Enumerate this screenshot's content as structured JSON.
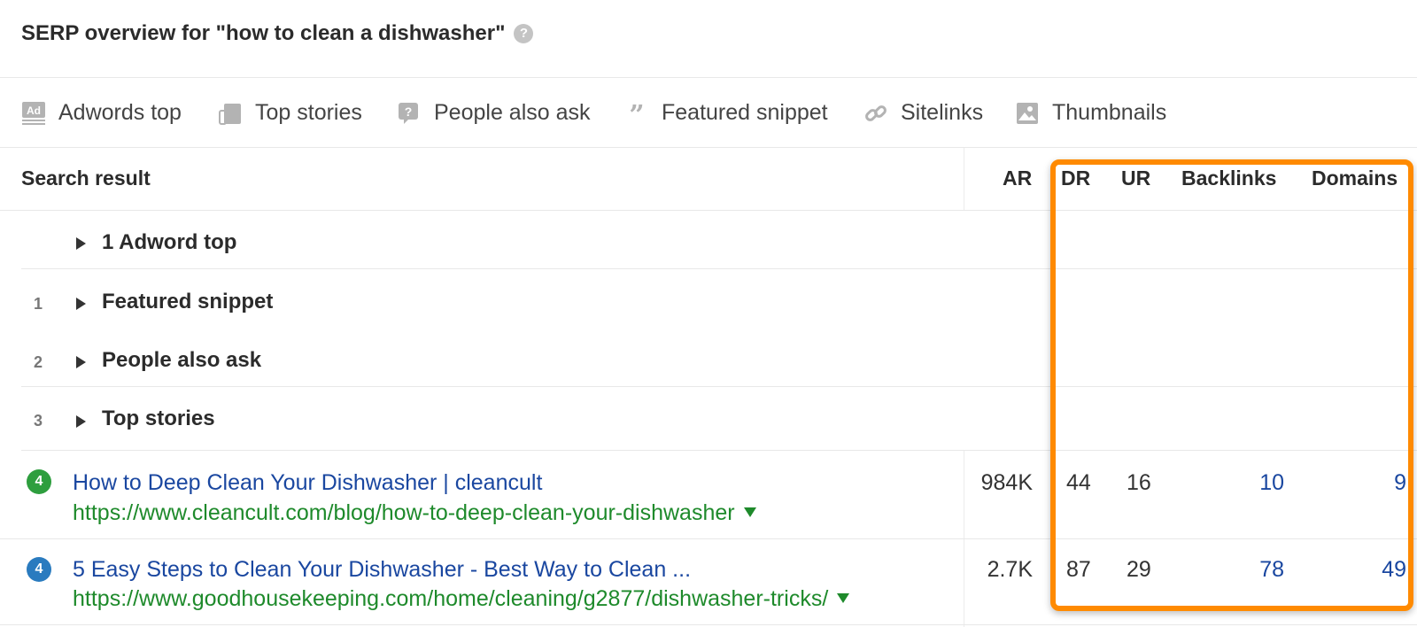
{
  "header": {
    "title": "SERP overview for \"how to clean a dishwasher\"",
    "help_icon": "?"
  },
  "features": [
    {
      "icon": "ad-icon",
      "label": "Adwords top"
    },
    {
      "icon": "top-stories-icon",
      "label": "Top stories"
    },
    {
      "icon": "question-bubble-icon",
      "label": "People also ask"
    },
    {
      "icon": "quote-icon",
      "label": "Featured snippet"
    },
    {
      "icon": "link-icon",
      "label": "Sitelinks"
    },
    {
      "icon": "image-icon",
      "label": "Thumbnails"
    }
  ],
  "table": {
    "columns": {
      "result": "Search result",
      "ar": "AR",
      "dr": "DR",
      "ur": "UR",
      "backlinks": "Backlinks",
      "domains": "Domains"
    },
    "groups": [
      {
        "position": "",
        "label": "1 Adword top"
      },
      {
        "position": "1",
        "label": "Featured snippet"
      },
      {
        "position": "2",
        "label": "People also ask"
      },
      {
        "position": "3",
        "label": "Top stories"
      }
    ],
    "results": [
      {
        "rank": "4",
        "rank_color": "#2e9e3e",
        "title": "How to Deep Clean Your Dishwasher | cleancult",
        "url": "https://www.cleancult.com/blog/how-to-deep-clean-your-dishwasher",
        "ar": "984K",
        "dr": "44",
        "ur": "16",
        "backlinks": "10",
        "domains": "9"
      },
      {
        "rank": "4",
        "rank_color": "#2a7bbf",
        "title": "5 Easy Steps to Clean Your Dishwasher - Best Way to Clean ...",
        "url": "https://www.goodhousekeeping.com/home/cleaning/g2877/dishwasher-tricks/",
        "ar": "2.7K",
        "dr": "87",
        "ur": "29",
        "backlinks": "78",
        "domains": "49"
      }
    ]
  },
  "colors": {
    "highlight": "#ff8a00",
    "link": "#1a47a0",
    "url": "#1e8a2b"
  }
}
